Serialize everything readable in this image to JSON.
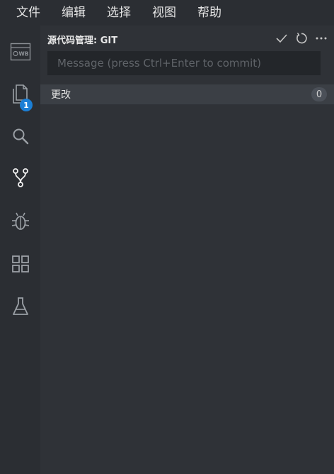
{
  "menubar": {
    "items": [
      "文件",
      "编辑",
      "选择",
      "视图",
      "帮助"
    ]
  },
  "activity_bar": {
    "items": [
      {
        "icon": "wb-browser-icon"
      },
      {
        "icon": "files-icon",
        "badge": "1"
      },
      {
        "icon": "search-icon"
      },
      {
        "icon": "source-control-icon"
      },
      {
        "icon": "debug-bug-icon"
      },
      {
        "icon": "extensions-icon"
      },
      {
        "icon": "flask-icon"
      }
    ]
  },
  "scm": {
    "title": "源代码管理: GIT",
    "actions": [
      {
        "icon": "check-icon"
      },
      {
        "icon": "refresh-icon"
      },
      {
        "icon": "more-icon"
      }
    ],
    "message_placeholder": "Message (press Ctrl+Enter to commit)",
    "message_value": "",
    "changes_label": "更改",
    "changes_count": "0"
  },
  "colors": {
    "background": "#2f3237",
    "activity_bar": "#2b2e33",
    "badge": "#1b7fd6",
    "changes_row": "#3b3f45"
  }
}
